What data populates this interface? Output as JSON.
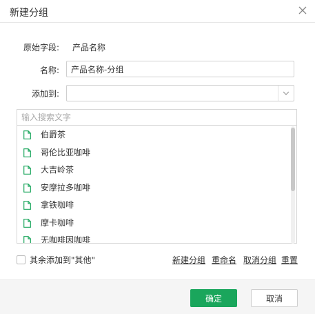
{
  "dialog": {
    "title": "新建分组"
  },
  "source": {
    "label": "原始字段:",
    "value": "产品名称"
  },
  "name": {
    "label": "名称:",
    "value": "产品名称-分组"
  },
  "add_to": {
    "label": "添加到:",
    "value": ""
  },
  "list": {
    "search_placeholder": "输入搜索文字",
    "items": [
      "伯爵茶",
      "哥伦比亚咖啡",
      "大吉岭茶",
      "安摩拉多咖啡",
      "拿铁咖啡",
      "摩卡咖啡",
      "无咖啡因咖啡"
    ]
  },
  "options": {
    "add_rest_label": "其余添加到\"其他\""
  },
  "actions": {
    "new_group": "新建分组",
    "rename": "重命名",
    "cancel_group": "取消分组",
    "reset": "重置"
  },
  "footer": {
    "ok": "确定",
    "cancel": "取消"
  },
  "colors": {
    "accent": "#1aa65c",
    "file_icon": "#1aa65c"
  }
}
